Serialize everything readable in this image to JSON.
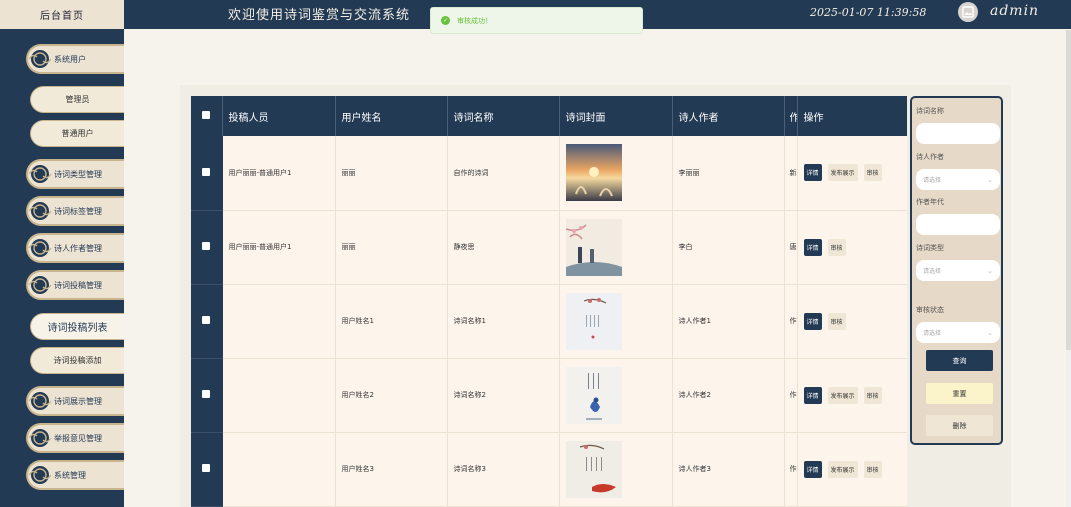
{
  "header": {
    "home_label": "后台首页",
    "site_title": "欢迎使用诗词鉴赏与交流系统",
    "datetime": "2025-01-07 11:39:58",
    "user": "admin"
  },
  "toast": {
    "message": "审核成功！"
  },
  "sidebar": {
    "items": [
      {
        "label": "系统用户"
      },
      {
        "label": "管理员"
      },
      {
        "label": "普通用户"
      },
      {
        "label": "诗词类型管理"
      },
      {
        "label": "诗词标签管理"
      },
      {
        "label": "诗人作者管理"
      },
      {
        "label": "诗词投稿管理"
      },
      {
        "label": "诗词投稿列表"
      },
      {
        "label": "诗词投稿添加"
      },
      {
        "label": "诗词展示管理"
      },
      {
        "label": "举报意见管理"
      },
      {
        "label": "系统管理"
      }
    ]
  },
  "table": {
    "columns": [
      "投稿人员",
      "用户姓名",
      "诗词名称",
      "诗词封面",
      "诗人作者",
      "作",
      "操作"
    ],
    "rows": [
      {
        "submitter": "用户丽丽-普通用户1",
        "username": "丽丽",
        "poem": "自作的诗词",
        "author": "李丽丽",
        "extra": "新",
        "actions": [
          "详情",
          "发布展示",
          "审核"
        ]
      },
      {
        "submitter": "用户丽丽-普通用户1",
        "username": "丽丽",
        "poem": "静夜思",
        "author": "李白",
        "extra": "唐",
        "actions": [
          "详情",
          "审核"
        ]
      },
      {
        "submitter": "",
        "username": "用户姓名1",
        "poem": "诗词名称1",
        "author": "诗人作者1",
        "extra": "作",
        "actions": [
          "详情",
          "审核"
        ]
      },
      {
        "submitter": "",
        "username": "用户姓名2",
        "poem": "诗词名称2",
        "author": "诗人作者2",
        "extra": "作",
        "actions": [
          "详情",
          "发布展示",
          "审核"
        ]
      },
      {
        "submitter": "",
        "username": "用户姓名3",
        "poem": "诗词名称3",
        "author": "诗人作者3",
        "extra": "作",
        "actions": [
          "详情",
          "发布展示",
          "审核"
        ]
      }
    ]
  },
  "search": {
    "poem_name_label": "诗词名称",
    "author_label": "诗人作者",
    "author_placeholder": "请选择",
    "era_label": "作者年代",
    "type_label": "诗词类型",
    "type_placeholder": "请选择",
    "status_label": "审核状态",
    "status_placeholder": "请选择",
    "query_label": "查询",
    "reset_label": "重置",
    "delete_label": "删除"
  },
  "colors": {
    "navy": "#233a54",
    "cream": "#ece3d3",
    "success": "#67c23a"
  }
}
